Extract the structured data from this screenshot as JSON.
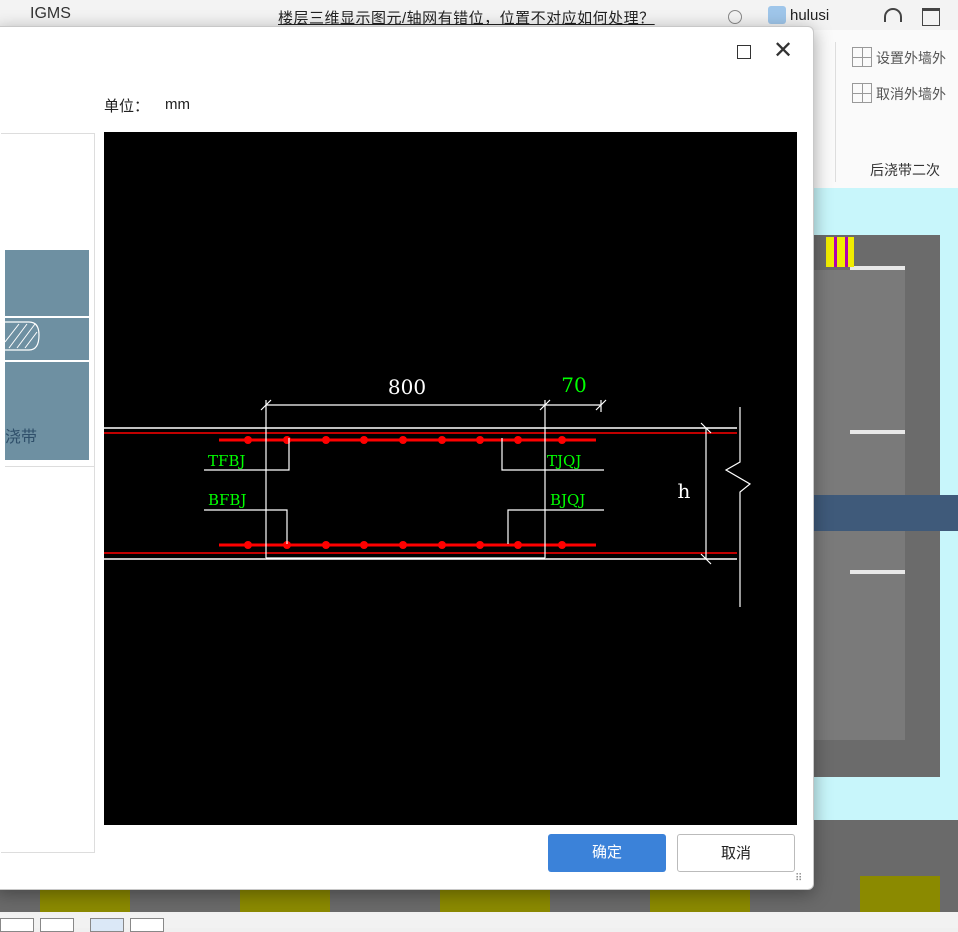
{
  "app": {
    "title": "IGMS",
    "search_text": "楼层三维显示图元/轴网有错位，位置不对应如何处理？",
    "user_name": "hulusi"
  },
  "ribbon": {
    "items": [
      {
        "label": "设置外墙外"
      },
      {
        "label": "取消外墙外"
      }
    ],
    "group_label": "后浇带二次"
  },
  "dialog": {
    "unit_label": "单位：",
    "unit_value": "mm",
    "thumbnail_label": "浇带",
    "ok_label": "确定",
    "cancel_label": "取消"
  },
  "drawing": {
    "dim_width": "800",
    "dim_overlap": "70",
    "height_label": "h",
    "bar_labels": {
      "top_far": "TFBJ",
      "bottom_far": "BFBJ",
      "top_add": "TJQJ",
      "bottom_add": "BJQJ"
    },
    "colors": {
      "background": "#000000",
      "rebar": "#ff0000",
      "label": "#00ff00",
      "line": "#ffffff"
    }
  }
}
